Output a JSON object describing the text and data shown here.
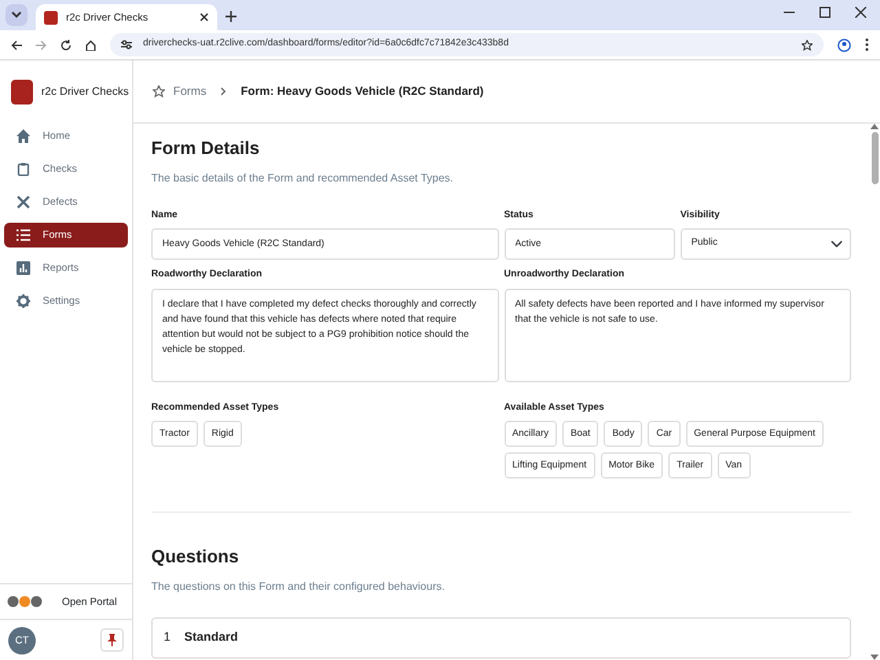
{
  "browser": {
    "tab_title": "r2c Driver Checks",
    "url": "driverchecks-uat.r2clive.com/dashboard/forms/editor?id=6a0c6dfc7c71842e3c433b8d"
  },
  "sidebar": {
    "app_name": "r2c Driver Checks",
    "items": [
      {
        "label": "Home",
        "selected": false
      },
      {
        "label": "Checks",
        "selected": false
      },
      {
        "label": "Defects",
        "selected": false
      },
      {
        "label": "Forms",
        "selected": true
      },
      {
        "label": "Reports",
        "selected": false
      },
      {
        "label": "Settings",
        "selected": false
      }
    ],
    "portal_link": "Open Portal",
    "avatar_initials": "CT"
  },
  "breadcrumb": {
    "parent": "Forms",
    "current": "Form: Heavy Goods Vehicle (R2C Standard)"
  },
  "form_details": {
    "title": "Form Details",
    "subtitle": "The basic details of the Form and recommended Asset Types.",
    "name": {
      "label": "Name",
      "value": "Heavy Goods Vehicle (R2C Standard)"
    },
    "status": {
      "label": "Status",
      "value": "Active"
    },
    "visibility": {
      "label": "Visibility",
      "value": "Public"
    },
    "roadworthy": {
      "label": "Roadworthy Declaration",
      "value": "I declare that I have completed my defect checks thoroughly and correctly and have found that this vehicle has defects where noted that require attention but would not be subject to a PG9 prohibition notice should the vehicle be stopped."
    },
    "unroadworthy": {
      "label": "Unroadworthy Declaration",
      "value": "All safety defects have been reported and I have informed my supervisor that the vehicle is not safe to use."
    },
    "recommended": {
      "label": "Recommended Asset Types",
      "items": [
        "Tractor",
        "Rigid"
      ]
    },
    "available": {
      "label": "Available Asset Types",
      "items": [
        "Ancillary",
        "Boat",
        "Body",
        "Car",
        "General Purpose Equipment",
        "Lifting Equipment",
        "Motor Bike",
        "Trailer",
        "Van"
      ]
    }
  },
  "questions": {
    "title": "Questions",
    "subtitle": "The questions on this Form and their configured behaviours.",
    "sections": [
      {
        "number": "1",
        "title": "Standard"
      }
    ]
  }
}
